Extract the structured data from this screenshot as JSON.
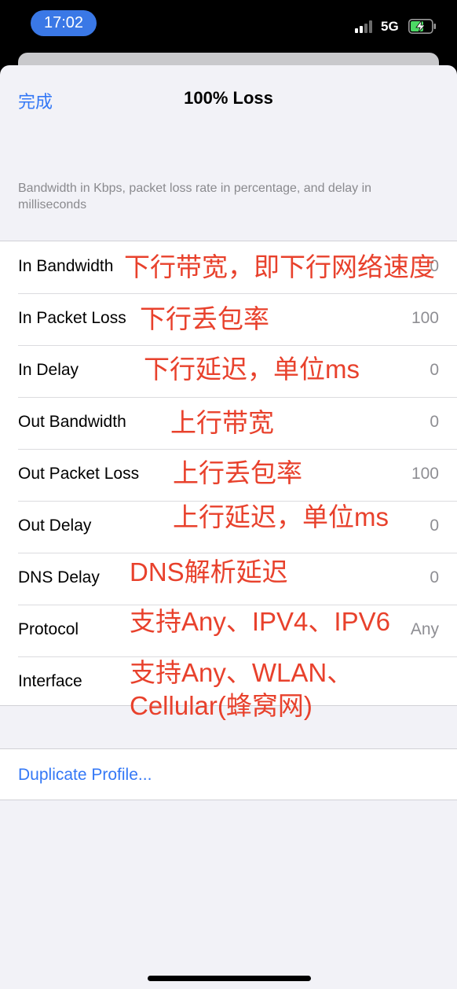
{
  "status_bar": {
    "time": "17:02",
    "network": "5G",
    "signal_bars_active": 2,
    "signal_bars_total": 4,
    "battery_state": "charging"
  },
  "nav": {
    "done_label": "完成",
    "title": "100% Loss"
  },
  "section_note": "Bandwidth in Kbps, packet loss rate in percentage, and delay in milliseconds",
  "rows": [
    {
      "label": "In Bandwidth",
      "value": "0"
    },
    {
      "label": "In Packet Loss",
      "value": "100"
    },
    {
      "label": "In Delay",
      "value": "0"
    },
    {
      "label": "Out Bandwidth",
      "value": "0"
    },
    {
      "label": "Out Packet Loss",
      "value": "100"
    },
    {
      "label": "Out Delay",
      "value": "0"
    },
    {
      "label": "DNS Delay",
      "value": "0"
    },
    {
      "label": "Protocol",
      "value": "Any"
    },
    {
      "label": "Interface",
      "value": ""
    }
  ],
  "annotations": [
    "下行带宽，即下行网络速度",
    "下行丢包率",
    "下行延迟，单位ms",
    "上行带宽",
    "上行丢包率",
    "上行延迟，单位ms",
    "DNS解析延迟",
    "支持Any、IPV4、IPV6",
    "支持Any、WLAN、",
    "Cellular(蜂窝网)"
  ],
  "duplicate_label": "Duplicate Profile...",
  "colors": {
    "accent": "#3478f6",
    "annotation": "#e8412c",
    "time_pill": "#3a78e6",
    "battery_fill": "#4cd964"
  }
}
